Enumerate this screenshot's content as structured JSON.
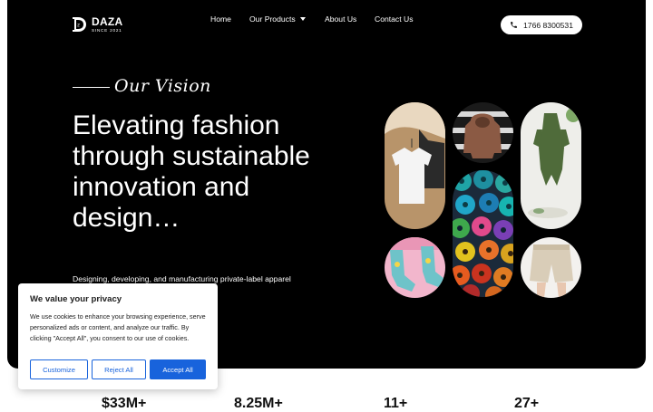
{
  "header": {
    "logo_name": "DAZA",
    "logo_since": "SINCE 2021",
    "nav": {
      "home": "Home",
      "products": "Our Products",
      "about": "About Us",
      "contact": "Contact Us"
    },
    "phone": "1766 8300531"
  },
  "hero": {
    "vision_label": "Our Vision",
    "headline": "Elevating fashion through sustainable innovation and design…",
    "subtext": "Designing, developing, and manufacturing private-label apparel for brands and retailers.",
    "images": [
      "tshirts-on-hangers",
      "brown-hoodie",
      "green-romper",
      "colorful-thread-spools",
      "pink-socks",
      "beige-shorts"
    ]
  },
  "cookie_banner": {
    "title": "We value your privacy",
    "body": "We use cookies to enhance your browsing experience, serve personalized ads or content, and analyze our traffic. By clicking \"Accept All\", you consent to our use of cookies.",
    "customize": "Customize",
    "reject": "Reject All",
    "accept": "Accept All"
  },
  "stats": [
    "$33M+",
    "8.25M+",
    "11+",
    "27+"
  ],
  "colors": {
    "hero_bg": "#000000",
    "accent_blue": "#1863dc",
    "text_dark": "#212121"
  }
}
